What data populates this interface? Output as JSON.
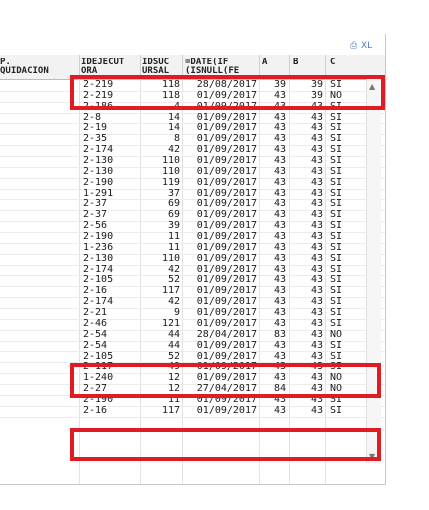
{
  "toolbar": {
    "print_icon": "⎙",
    "export_label": "XL"
  },
  "columns": [
    {
      "key": "liq",
      "label": "P.\nQUIDACION"
    },
    {
      "key": "id",
      "label": "IDEJECUT\nORA"
    },
    {
      "key": "suc",
      "label": "IDSUC\nURSAL"
    },
    {
      "key": "date",
      "label": "=DATE(IF\n(ISNULL(FE"
    },
    {
      "key": "a",
      "label": "A"
    },
    {
      "key": "b",
      "label": "B"
    },
    {
      "key": "c",
      "label": "C"
    }
  ],
  "rows": [
    [
      "2-219",
      "118",
      "28/08/2017",
      "39",
      "39",
      "SI"
    ],
    [
      "2-219",
      "118",
      "01/09/2017",
      "43",
      "39",
      "NO"
    ],
    [
      "2-186",
      "4",
      "01/09/2017",
      "43",
      "43",
      "SI"
    ],
    [
      "2-8",
      "14",
      "01/09/2017",
      "43",
      "43",
      "SI"
    ],
    [
      "2-19",
      "14",
      "01/09/2017",
      "43",
      "43",
      "SI"
    ],
    [
      "2-35",
      "8",
      "01/09/2017",
      "43",
      "43",
      "SI"
    ],
    [
      "2-174",
      "42",
      "01/09/2017",
      "43",
      "43",
      "SI"
    ],
    [
      "2-130",
      "110",
      "01/09/2017",
      "43",
      "43",
      "SI"
    ],
    [
      "2-130",
      "110",
      "01/09/2017",
      "43",
      "43",
      "SI"
    ],
    [
      "2-190",
      "119",
      "01/09/2017",
      "43",
      "43",
      "SI"
    ],
    [
      "1-291",
      "37",
      "01/09/2017",
      "43",
      "43",
      "SI"
    ],
    [
      "2-37",
      "69",
      "01/09/2017",
      "43",
      "43",
      "SI"
    ],
    [
      "2-37",
      "69",
      "01/09/2017",
      "43",
      "43",
      "SI"
    ],
    [
      "2-56",
      "39",
      "01/09/2017",
      "43",
      "43",
      "SI"
    ],
    [
      "2-190",
      "11",
      "01/09/2017",
      "43",
      "43",
      "SI"
    ],
    [
      "1-236",
      "11",
      "01/09/2017",
      "43",
      "43",
      "SI"
    ],
    [
      "2-130",
      "110",
      "01/09/2017",
      "43",
      "43",
      "SI"
    ],
    [
      "2-174",
      "42",
      "01/09/2017",
      "43",
      "43",
      "SI"
    ],
    [
      "2-105",
      "52",
      "01/09/2017",
      "43",
      "43",
      "SI"
    ],
    [
      "2-16",
      "117",
      "01/09/2017",
      "43",
      "43",
      "SI"
    ],
    [
      "2-174",
      "42",
      "01/09/2017",
      "43",
      "43",
      "SI"
    ],
    [
      "2-21",
      "9",
      "01/09/2017",
      "43",
      "43",
      "SI"
    ],
    [
      "2-46",
      "121",
      "01/09/2017",
      "43",
      "43",
      "SI"
    ],
    [
      "2-54",
      "44",
      "28/04/2017",
      "83",
      "43",
      "NO"
    ],
    [
      "2-54",
      "44",
      "01/09/2017",
      "43",
      "43",
      "SI"
    ],
    [
      "2-105",
      "52",
      "01/09/2017",
      "43",
      "43",
      "SI"
    ],
    [
      "2-117",
      "49",
      "01/09/2017",
      "43",
      "43",
      "SI"
    ],
    [
      "1-240",
      "12",
      "01/09/2017",
      "43",
      "43",
      "NO"
    ],
    [
      "2-27",
      "12",
      "27/04/2017",
      "84",
      "43",
      "NO"
    ],
    [
      "2-190",
      "11",
      "01/09/2017",
      "43",
      "43",
      "SI"
    ],
    [
      "2-16",
      "117",
      "01/09/2017",
      "43",
      "43",
      "SI"
    ]
  ],
  "scroll": {
    "up_icon": "▲",
    "down_icon": "▼"
  },
  "highlight_color": "#e11b22"
}
